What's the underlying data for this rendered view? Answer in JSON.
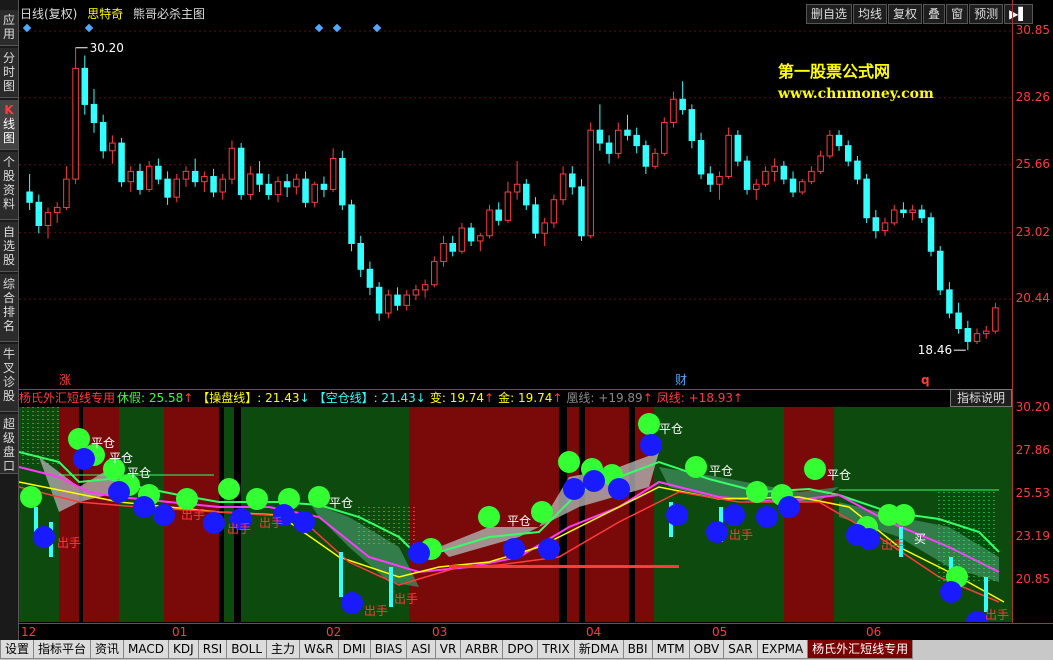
{
  "left_tabs": [
    {
      "label": "应用"
    },
    {
      "label": "分时图"
    },
    {
      "label_k": "K",
      "label": "线图",
      "active": true
    },
    {
      "label": "个股资料"
    },
    {
      "label": "自选股"
    },
    {
      "label": "综合排名"
    },
    {
      "label": "牛叉诊股"
    },
    {
      "label": "超级盘口"
    }
  ],
  "header": {
    "period": "日线(复权)",
    "stock_name": "思特奇",
    "formula_name": "熊哥必杀主图"
  },
  "toolbar": {
    "buttons": [
      "删自选",
      "均线",
      "复权",
      "叠",
      "窗",
      "预测"
    ],
    "more_icon": "▶▌"
  },
  "watermark": {
    "line1": "第一股票公式网",
    "line2": "www.chnmoney.com"
  },
  "price_chart": {
    "axis_labels": [
      "30.85",
      "28.26",
      "25.66",
      "23.02",
      "20.44"
    ],
    "high_label": "30.20",
    "low_label": "18.46",
    "markers": {
      "zhang": "涨",
      "cai": "财",
      "q": "q"
    }
  },
  "indicator": {
    "name": "杨氏外汇短线专用",
    "items": [
      {
        "label": "休假",
        "value": ": 25.58",
        "arrow": "↑",
        "color": "#33ff33"
      },
      {
        "label": "【操盘线】",
        "value": ": 21.43",
        "arrow": "↓",
        "color": "#ffff00"
      },
      {
        "label": "【空仓线】",
        "value": ": 21.43",
        "arrow": "↓",
        "color": "#33ffff"
      },
      {
        "label": "变",
        "value": ": 19.74",
        "arrow": "↑",
        "color": "#ffff00"
      },
      {
        "label": "金",
        "value": ": 19.74",
        "arrow": "↑",
        "color": "#ffff00"
      },
      {
        "label": "凰线",
        "value": ": +19.89",
        "arrow": "↑",
        "color": "#888888"
      },
      {
        "label": "凤线",
        "value": ": +18.93",
        "arrow": "↑",
        "color": "#ff3b3b"
      }
    ],
    "explain_button": "指标说明",
    "axis_labels": [
      "30.20",
      "27.86",
      "25.53",
      "23.19",
      "20.85"
    ],
    "signal_ping": "平仓",
    "signal_chu": "出手",
    "signal_mai": "买"
  },
  "date_axis": [
    "12",
    "01",
    "02",
    "03",
    "04",
    "05",
    "06"
  ],
  "bottom_tabs": [
    "设置",
    "指标平台",
    "资讯",
    "MACD",
    "KDJ",
    "RSI",
    "BOLL",
    "主力",
    "W&R",
    "DMI",
    "BIAS",
    "ASI",
    "VR",
    "ARBR",
    "DPO",
    "TRIX",
    "新DMA",
    "BBI",
    "MTM",
    "OBV",
    "SAR",
    "EXPMA",
    "杨氏外汇短线专用"
  ],
  "bottom_tab_active": "杨氏外汇短线专用",
  "colors": {
    "up": "#ff3b3b",
    "down": "#33ffff",
    "accent": "#ffff00"
  },
  "chart_data": {
    "type": "candlestick",
    "ylim": [
      18.0,
      31.2
    ],
    "ohlc": [
      [
        24.6,
        25.3,
        23.9,
        24.2
      ],
      [
        24.2,
        24.5,
        23.0,
        23.3
      ],
      [
        23.3,
        24.0,
        22.8,
        23.8
      ],
      [
        23.8,
        24.2,
        23.4,
        24.0
      ],
      [
        24.0,
        25.6,
        23.9,
        25.1
      ],
      [
        25.1,
        30.2,
        24.9,
        29.4
      ],
      [
        29.4,
        29.9,
        27.6,
        28.0
      ],
      [
        28.0,
        28.6,
        26.9,
        27.3
      ],
      [
        27.3,
        27.6,
        25.9,
        26.2
      ],
      [
        26.2,
        26.8,
        25.7,
        26.5
      ],
      [
        26.5,
        26.7,
        24.8,
        25.0
      ],
      [
        25.0,
        25.6,
        24.6,
        25.4
      ],
      [
        25.4,
        25.7,
        24.5,
        24.7
      ],
      [
        24.7,
        25.8,
        24.6,
        25.6
      ],
      [
        25.6,
        25.9,
        24.9,
        25.1
      ],
      [
        25.1,
        25.4,
        24.1,
        24.4
      ],
      [
        24.4,
        25.3,
        24.2,
        25.1
      ],
      [
        25.1,
        25.6,
        24.8,
        25.4
      ],
      [
        25.4,
        25.9,
        24.8,
        25.0
      ],
      [
        25.0,
        25.4,
        24.6,
        25.2
      ],
      [
        25.2,
        25.5,
        24.4,
        24.6
      ],
      [
        24.6,
        25.3,
        24.3,
        25.1
      ],
      [
        25.1,
        26.6,
        24.9,
        26.3
      ],
      [
        26.3,
        26.5,
        24.3,
        24.5
      ],
      [
        24.5,
        25.6,
        24.3,
        25.3
      ],
      [
        25.3,
        25.8,
        24.6,
        24.9
      ],
      [
        24.9,
        25.3,
        24.3,
        24.5
      ],
      [
        24.5,
        25.2,
        24.2,
        25.0
      ],
      [
        25.0,
        25.3,
        24.4,
        24.8
      ],
      [
        24.8,
        25.3,
        24.5,
        25.1
      ],
      [
        25.1,
        25.4,
        24.0,
        24.2
      ],
      [
        24.2,
        25.0,
        24.0,
        24.9
      ],
      [
        24.9,
        25.2,
        24.4,
        24.7
      ],
      [
        24.7,
        26.3,
        24.6,
        25.9
      ],
      [
        25.9,
        26.2,
        23.9,
        24.1
      ],
      [
        24.1,
        24.3,
        22.3,
        22.6
      ],
      [
        22.6,
        22.9,
        21.3,
        21.6
      ],
      [
        21.6,
        21.9,
        20.6,
        20.9
      ],
      [
        20.9,
        21.1,
        19.6,
        19.9
      ],
      [
        19.9,
        20.8,
        19.7,
        20.6
      ],
      [
        20.6,
        20.9,
        20.0,
        20.2
      ],
      [
        20.2,
        20.8,
        20.0,
        20.6
      ],
      [
        20.6,
        21.0,
        20.4,
        20.8
      ],
      [
        20.8,
        21.2,
        20.5,
        21.0
      ],
      [
        21.0,
        22.1,
        20.9,
        21.9
      ],
      [
        21.9,
        22.9,
        21.7,
        22.6
      ],
      [
        22.6,
        22.9,
        22.1,
        22.3
      ],
      [
        22.3,
        23.4,
        22.2,
        23.2
      ],
      [
        23.2,
        23.4,
        22.5,
        22.7
      ],
      [
        22.7,
        23.0,
        22.3,
        22.9
      ],
      [
        22.9,
        24.1,
        22.8,
        23.9
      ],
      [
        23.9,
        24.2,
        23.3,
        23.5
      ],
      [
        23.5,
        25.0,
        23.4,
        24.6
      ],
      [
        24.6,
        25.8,
        24.3,
        24.9
      ],
      [
        24.9,
        25.1,
        23.9,
        24.1
      ],
      [
        24.1,
        24.4,
        22.8,
        23.0
      ],
      [
        23.0,
        23.6,
        22.5,
        23.4
      ],
      [
        23.4,
        24.5,
        23.2,
        24.3
      ],
      [
        24.3,
        25.6,
        24.1,
        25.3
      ],
      [
        25.3,
        25.6,
        24.5,
        24.8
      ],
      [
        24.8,
        25.1,
        22.7,
        22.9
      ],
      [
        22.9,
        27.3,
        22.8,
        27.0
      ],
      [
        27.0,
        28.0,
        26.2,
        26.5
      ],
      [
        26.5,
        26.8,
        25.7,
        26.1
      ],
      [
        26.1,
        27.3,
        25.9,
        27.0
      ],
      [
        27.0,
        27.6,
        26.6,
        26.8
      ],
      [
        26.8,
        27.1,
        26.1,
        26.4
      ],
      [
        26.4,
        26.6,
        25.3,
        25.6
      ],
      [
        25.6,
        26.3,
        25.5,
        26.1
      ],
      [
        26.1,
        27.5,
        26.0,
        27.3
      ],
      [
        27.3,
        28.5,
        27.1,
        28.2
      ],
      [
        28.2,
        28.9,
        27.6,
        27.8
      ],
      [
        27.8,
        28.0,
        26.3,
        26.6
      ],
      [
        26.6,
        26.9,
        25.1,
        25.3
      ],
      [
        25.3,
        25.6,
        24.6,
        24.9
      ],
      [
        24.9,
        25.4,
        24.3,
        25.2
      ],
      [
        25.2,
        27.1,
        25.1,
        26.8
      ],
      [
        26.8,
        27.0,
        25.6,
        25.8
      ],
      [
        25.8,
        26.0,
        24.5,
        24.7
      ],
      [
        24.7,
        25.1,
        24.3,
        24.9
      ],
      [
        24.9,
        25.6,
        24.8,
        25.4
      ],
      [
        25.4,
        25.9,
        25.0,
        25.6
      ],
      [
        25.6,
        25.8,
        24.9,
        25.1
      ],
      [
        25.1,
        25.4,
        24.4,
        24.6
      ],
      [
        24.6,
        25.1,
        24.5,
        25.0
      ],
      [
        25.0,
        25.6,
        24.9,
        25.4
      ],
      [
        25.4,
        26.2,
        25.3,
        26.0
      ],
      [
        26.0,
        27.0,
        25.9,
        26.8
      ],
      [
        26.8,
        27.0,
        26.2,
        26.4
      ],
      [
        26.4,
        26.6,
        25.6,
        25.8
      ],
      [
        25.8,
        26.0,
        24.9,
        25.1
      ],
      [
        25.1,
        25.3,
        23.4,
        23.6
      ],
      [
        23.6,
        23.9,
        22.8,
        23.1
      ],
      [
        23.1,
        23.6,
        22.9,
        23.4
      ],
      [
        23.4,
        24.1,
        23.3,
        23.9
      ],
      [
        23.9,
        24.2,
        23.6,
        23.8
      ],
      [
        23.8,
        24.1,
        23.5,
        23.9
      ],
      [
        23.9,
        24.1,
        23.4,
        23.6
      ],
      [
        23.6,
        23.8,
        22.1,
        22.3
      ],
      [
        22.3,
        22.5,
        20.6,
        20.8
      ],
      [
        20.8,
        21.1,
        19.7,
        19.9
      ],
      [
        19.9,
        20.3,
        19.1,
        19.3
      ],
      [
        19.3,
        19.6,
        18.46,
        18.8
      ],
      [
        18.8,
        19.3,
        18.7,
        19.1
      ],
      [
        19.1,
        19.4,
        18.9,
        19.2
      ],
      [
        19.2,
        20.3,
        19.1,
        20.1
      ]
    ]
  }
}
